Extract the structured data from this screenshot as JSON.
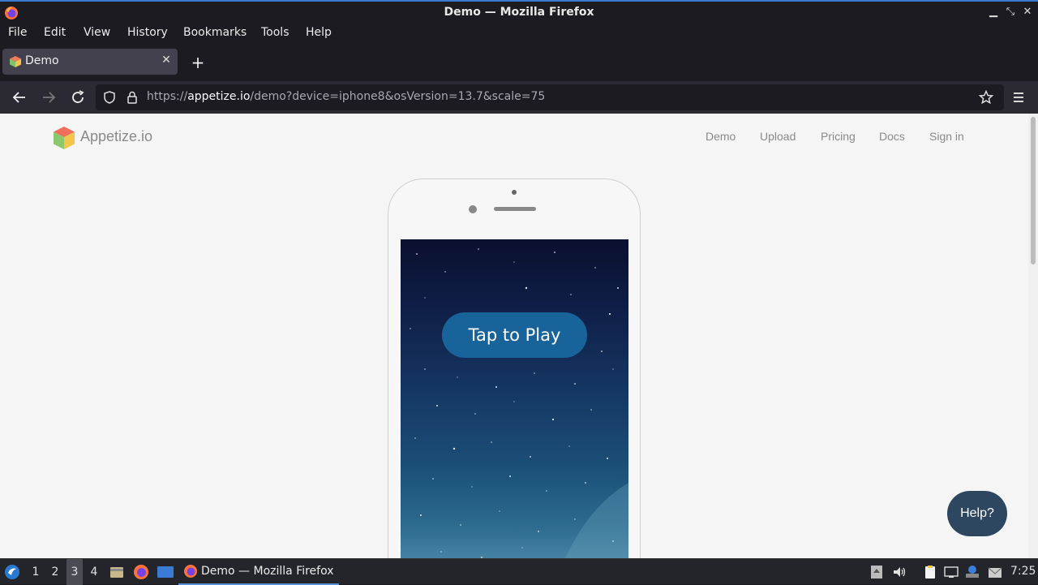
{
  "window": {
    "title": "Demo — Mozilla Firefox",
    "controls": [
      "minimize-icon",
      "restore-icon",
      "close-icon"
    ]
  },
  "menu": {
    "items": [
      "File",
      "Edit",
      "View",
      "History",
      "Bookmarks",
      "Tools",
      "Help"
    ]
  },
  "tabs": [
    {
      "label": "Demo",
      "active": true
    }
  ],
  "navbar": {
    "url_prefix": "https://",
    "url_host": "appetize.io",
    "url_path": "/demo?device=iphone8&osVersion=13.7&scale=75"
  },
  "site": {
    "logo_text": "Appetize.io",
    "nav": [
      "Demo",
      "Upload",
      "Pricing",
      "Docs",
      "Sign in"
    ]
  },
  "device": {
    "screen_button": "Tap to Play"
  },
  "help_button": "Help?",
  "taskbar": {
    "workspaces": [
      "1",
      "2",
      "3",
      "4"
    ],
    "active_workspace": "3",
    "task_label": "Demo — Mozilla Firefox",
    "clock": "7:25"
  },
  "colors": {
    "accent": "#3c7bd4",
    "page_bg": "#f5f5f5",
    "play_button": "#17639a",
    "help_button": "#2d4760"
  }
}
